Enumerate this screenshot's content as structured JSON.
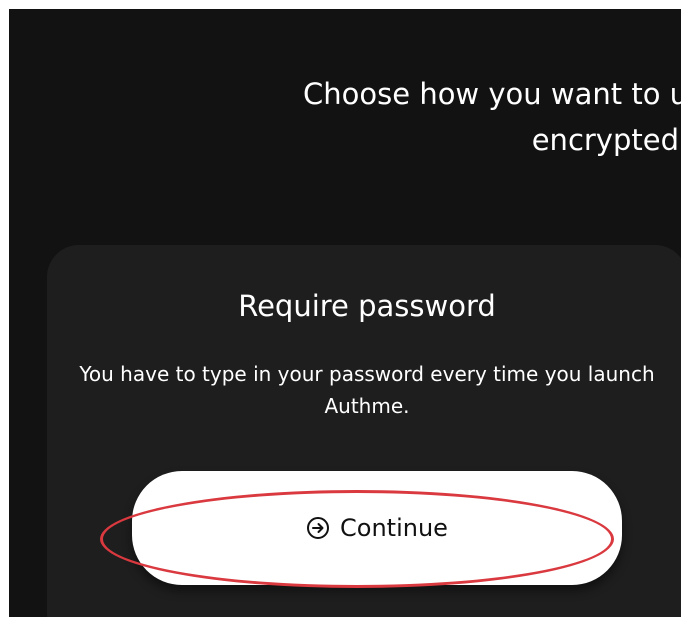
{
  "heading": {
    "line1": "Choose how you want to use",
    "line2": "encrypted"
  },
  "card": {
    "title": "Require password",
    "description": "You have to type in your password every time you launch Authme."
  },
  "button": {
    "label": "Continue",
    "icon": "arrow-circle-right-icon"
  },
  "annotation": {
    "color": "#d9393f"
  },
  "colors": {
    "background": "#121212",
    "card": "#1e1e1e",
    "button": "#ffffff"
  }
}
